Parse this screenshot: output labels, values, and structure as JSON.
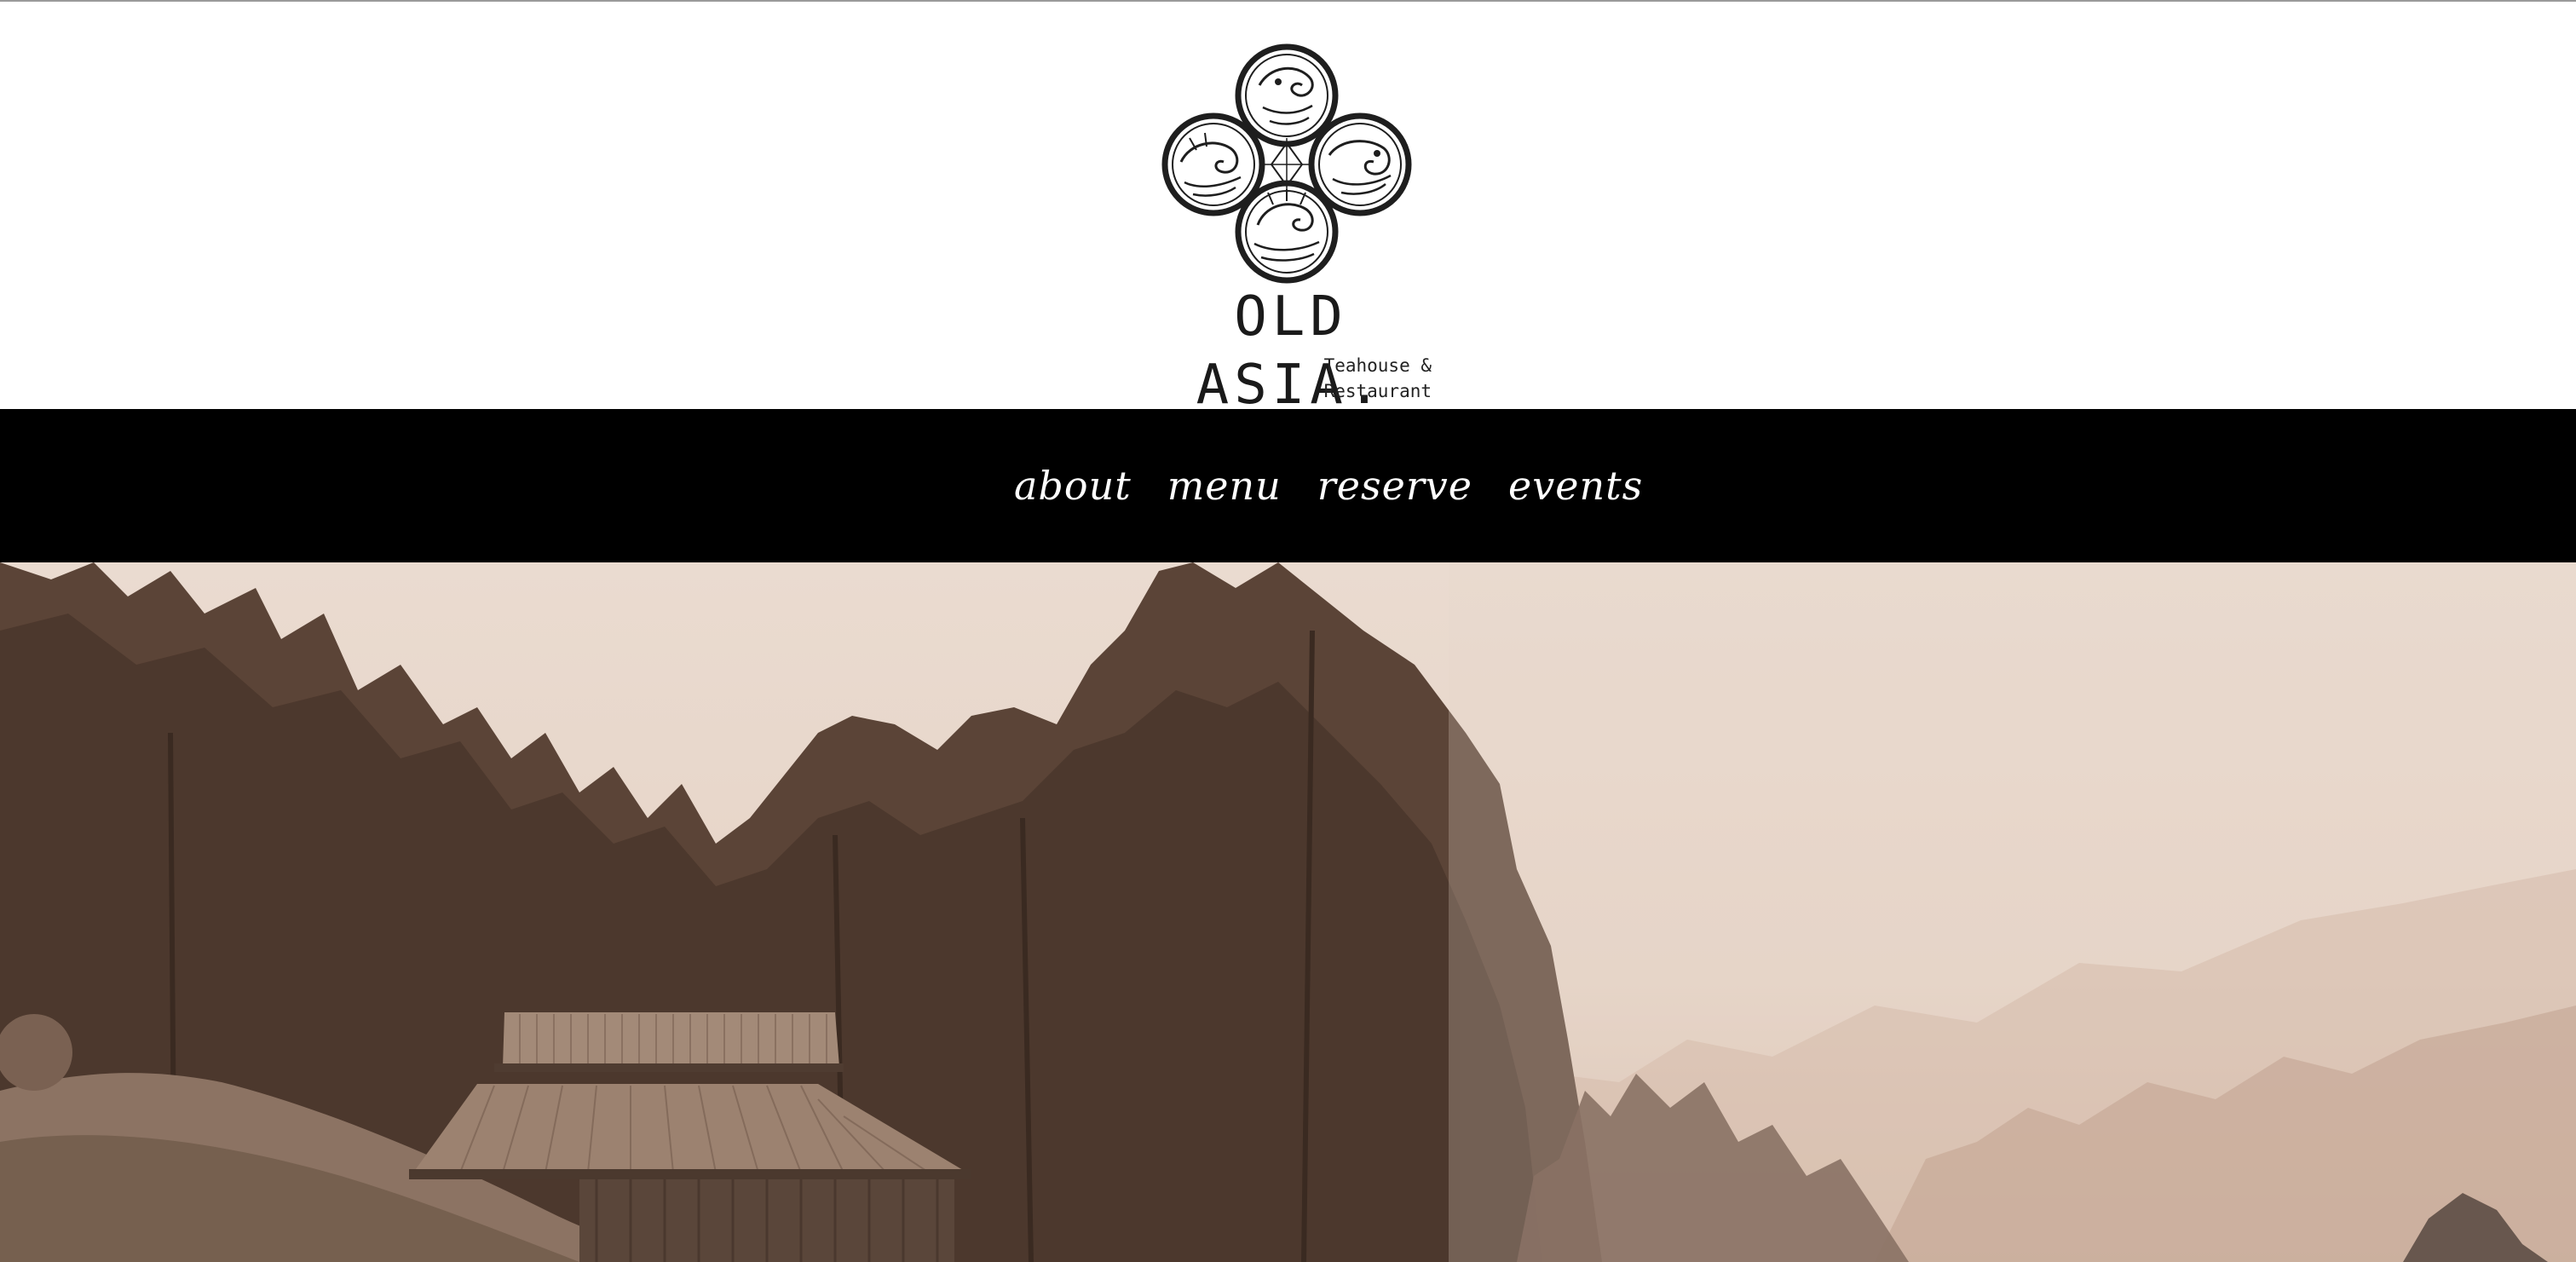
{
  "brand": {
    "name": "OLD ASIA.",
    "tagline": "Teahouse & Restaurant",
    "emblem_icon": "four-circle-dragon-emblem-icon"
  },
  "nav": {
    "items": [
      {
        "label": "about"
      },
      {
        "label": "menu"
      },
      {
        "label": "reserve"
      },
      {
        "label": "events"
      }
    ]
  },
  "hero": {
    "image": "sepia-tea-plantation-photo",
    "tone": "#e7d7cb"
  },
  "colors": {
    "nav_background": "#000000",
    "nav_text": "#ffffff",
    "header_background": "#ffffff"
  }
}
